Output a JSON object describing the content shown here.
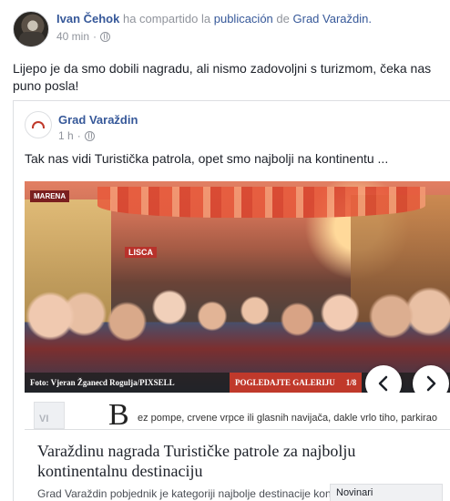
{
  "post": {
    "author": "Ivan Čehok",
    "action": "ha compartido la",
    "object": "publicación",
    "preposition": "de",
    "page": "Grad Varaždin.",
    "time": "40 min",
    "separator": "·",
    "text": "Lijepo je da smo dobili nagradu, ali nismo zadovoljni s turizmom, čeka nas puno posla!"
  },
  "shared": {
    "page_name": "Grad Varaždin",
    "time": "1 h",
    "separator": "·",
    "text": "Tak nas vidi Turistička patrola, opet smo najbolji na kontinentu ..."
  },
  "photo": {
    "caption": "Foto: Vjeran Žganecd Rogulja/PIXSELL",
    "gallery_label": "POGLEDAJTE GALERIJU",
    "gallery_count": "1/8",
    "sign_lisca": "LISCA",
    "sign_left": "MARENA"
  },
  "article": {
    "thumb_text": "VI",
    "dropcap": "B",
    "excerpt": "ez pompe, crvene vrpce ili glasnih navijača, dakle vrlo tiho, parkirao"
  },
  "link": {
    "title": "Varaždinu nagrada Turističke patrole za najbolju kontinentalnu destinaciju",
    "description": "Grad Varaždin pobjednik je kategoriji najbolje destinacije kontinenta"
  },
  "tag": "Novinari",
  "icons": {
    "privacy": "globe-icon",
    "prev": "chevron-left-icon",
    "next": "chevron-right-icon"
  },
  "colors": {
    "link_blue": "#365899",
    "muted": "#90949c",
    "gallery_red": "#c0392b"
  }
}
